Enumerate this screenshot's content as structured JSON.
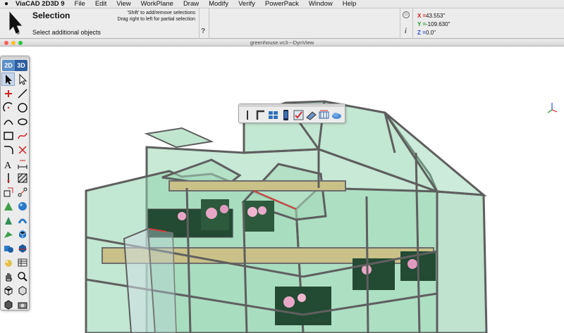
{
  "menubar": {
    "app_name": "ViaCAD 2D3D 9",
    "items": [
      "File",
      "Edit",
      "View",
      "WorkPlane",
      "Draw",
      "Modify",
      "Verify",
      "PowerPack",
      "Window",
      "Help"
    ]
  },
  "tool_info": {
    "title": "Selection",
    "prompt": "Select additional objects",
    "hint_line1": "'Shift' to add/remove selections",
    "hint_line2": "Drag right to left for partial selection",
    "help_glyph": "?",
    "info_glyph": "i"
  },
  "coordinates": {
    "x_label": "X =",
    "x_value": "43.553\"",
    "y_label": "Y =",
    "y_value": "-109.630\"",
    "z_label": "Z =",
    "z_value": "0.0\""
  },
  "document": {
    "title": "greenhouse.vc3---DynView"
  },
  "palette": {
    "tab_2d": "2D",
    "tab_3d": "3D",
    "tools": [
      "select-arrow",
      "select-hollow-arrow",
      "point",
      "line",
      "arc",
      "circle",
      "arc-three-point",
      "ellipse",
      "rectangle",
      "spline",
      "fillet",
      "trim",
      "text",
      "dimension",
      "centerline",
      "hatch",
      "transform",
      "array",
      "extrude",
      "sphere",
      "revolve",
      "solid-shell",
      "loft",
      "box-cube",
      "boolean",
      "solid-split",
      "render-sphere",
      "render-table",
      "pan-hand",
      "zoom-magnifier",
      "view-cube",
      "view-wireframe",
      "view-shaded",
      "view-camera"
    ]
  },
  "view_toolbar": {
    "icons": [
      "section-plane-icon",
      "corner-profile-icon",
      "grid-layout-icon",
      "mobile-icon",
      "map-check-icon",
      "snap-wall-icon",
      "wall-tool-icon",
      "cloud-icon"
    ]
  },
  "colors": {
    "glass": "#8fd3ad",
    "frame": "#6d6d6d",
    "axis_x": "#d21d1d",
    "axis_y": "#1e9a2b",
    "axis_z": "#2a4fd4"
  }
}
